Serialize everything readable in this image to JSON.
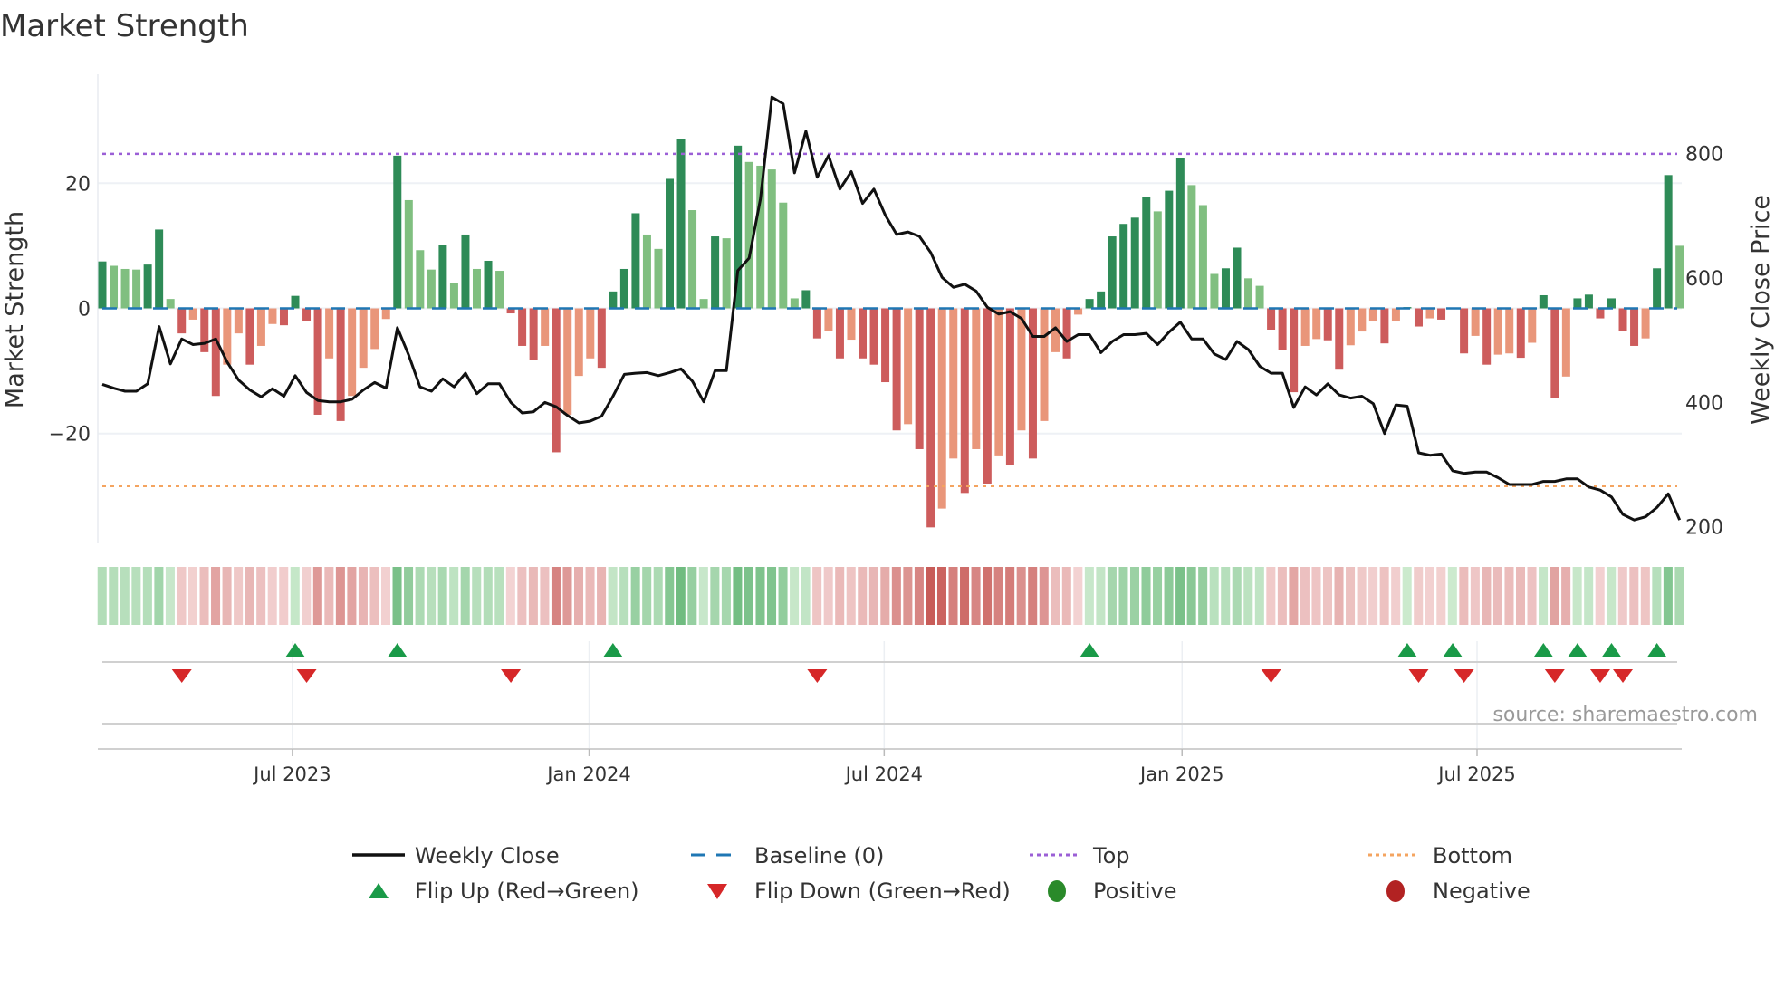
{
  "title": "Market Strength",
  "source": "source: sharemaestro.com",
  "colors": {
    "pos_strong": "#2e8b57",
    "pos_weak": "#80bf80",
    "neg_strong": "#cd5c5c",
    "neg_weak": "#e9967a",
    "line": "#111111",
    "baseline": "#1f77b4",
    "top": "#9b5fd6",
    "bottom": "#f4a460",
    "flip_up": "#1a9a48",
    "flip_down": "#d62728",
    "positive": "#2a8a2a",
    "negative": "#b22222"
  },
  "legend": {
    "weekly_close": "Weekly Close",
    "baseline": "Baseline (0)",
    "top": "Top",
    "bottom": "Bottom",
    "flip_up": "Flip Up (Red→Green)",
    "flip_down": "Flip Down (Green→Red)",
    "positive": "Positive",
    "negative": "Negative"
  },
  "chart_data": {
    "type": "bar",
    "title": "Market Strength",
    "ylabel": "Market Strength",
    "y2label": "Weekly Close Price",
    "ylim": [
      -37,
      37
    ],
    "y2lim": [
      140,
      940
    ],
    "yticks": [
      {
        "value": 20,
        "label": "20"
      },
      {
        "value": 0,
        "label": "0"
      },
      {
        "value": -20,
        "label": "−20"
      }
    ],
    "y2ticks": [
      {
        "value": 800,
        "label": "800"
      },
      {
        "value": 600,
        "label": "600"
      },
      {
        "value": 400,
        "label": "400"
      },
      {
        "value": 200,
        "label": "200"
      }
    ],
    "top_level": 24.7,
    "bottom_level": -28.4,
    "baseline": 0,
    "xticks": [
      {
        "week": 17.75,
        "label": "Jul 2023"
      },
      {
        "week": 43.9,
        "label": "Jan 2024"
      },
      {
        "week": 69.9,
        "label": "Jul 2024"
      },
      {
        "week": 96.15,
        "label": "Jan 2025"
      },
      {
        "week": 122.15,
        "label": "Jul 2025"
      }
    ],
    "strength": [
      7.5,
      6.8,
      6.3,
      6.2,
      7,
      12.6,
      1.5,
      -4,
      -1.8,
      -7,
      -14,
      -9,
      -4,
      -9,
      -6,
      -2.5,
      -2.7,
      2,
      -2,
      -17,
      -8,
      -18,
      -14,
      -9.5,
      -6.5,
      -1.7,
      24.4,
      17.3,
      9.3,
      6.2,
      10.2,
      4,
      11.8,
      6.3,
      7.6,
      6,
      -0.8,
      -6,
      -8.2,
      -6,
      -23,
      -17,
      -10.8,
      -8,
      -9.5,
      2.7,
      6.3,
      15.2,
      11.8,
      9.5,
      20.7,
      27,
      15.7,
      1.5,
      11.5,
      11.2,
      26,
      23.4,
      22.8,
      22.2,
      16.9,
      1.6,
      2.9,
      -4.8,
      -3.6,
      -8,
      -5,
      -8,
      -9,
      -11.8,
      -19.5,
      -18.5,
      -22.5,
      -35,
      -32,
      -24,
      -29.5,
      -22.5,
      -28,
      -23.5,
      -25,
      -19.5,
      -24,
      -18,
      -7,
      -8,
      -1,
      1.5,
      2.7,
      11.5,
      13.5,
      14.5,
      17.8,
      15.5,
      18.8,
      24,
      19.7,
      16.5,
      5.5,
      6.4,
      9.7,
      4.8,
      3.6,
      -3.4,
      -6.7,
      -13.4,
      -6,
      -4.9,
      -5.1,
      -9.8,
      -5.9,
      -3.7,
      -2.1,
      -5.6,
      -2.1,
      0.2,
      -2.9,
      -1.6,
      -1.8,
      0.1,
      -7.2,
      -4.4,
      -9,
      -7.4,
      -7.2,
      -7.9,
      -5.5,
      2.1,
      -14.3,
      -10.9,
      1.6,
      2.2,
      -1.6,
      1.6,
      -3.6,
      -6,
      -4.8,
      6.4,
      21.3,
      10
    ],
    "weekly_close": [
      429,
      423,
      418,
      418,
      430,
      522,
      462,
      502,
      493,
      495,
      502,
      465,
      436,
      420,
      409,
      422,
      410,
      443,
      416,
      403,
      401,
      401,
      405,
      420,
      432,
      423,
      520,
      476,
      425,
      418,
      438,
      425,
      447,
      414,
      430,
      430,
      400,
      383,
      385,
      400,
      393,
      379,
      367,
      370,
      378,
      410,
      445,
      447,
      448,
      443,
      448,
      454,
      434,
      401,
      451,
      451,
      612,
      632,
      727,
      891,
      880,
      769,
      836,
      762,
      797,
      743,
      771,
      720,
      743,
      701,
      670,
      674,
      667,
      641,
      601,
      585,
      590,
      579,
      553,
      542,
      546,
      535,
      506,
      506,
      520,
      498,
      509,
      509,
      480,
      498,
      509,
      509,
      511,
      493,
      513,
      529,
      502,
      502,
      478,
      469,
      498,
      485,
      458,
      447,
      447,
      392,
      425,
      412,
      430,
      412,
      407,
      410,
      398,
      350,
      396,
      394,
      319,
      315,
      317,
      290,
      286,
      288,
      288,
      279,
      268,
      268,
      268,
      273,
      273,
      277,
      277,
      264,
      259,
      248,
      220,
      211,
      216,
      231,
      253,
      211
    ]
  }
}
